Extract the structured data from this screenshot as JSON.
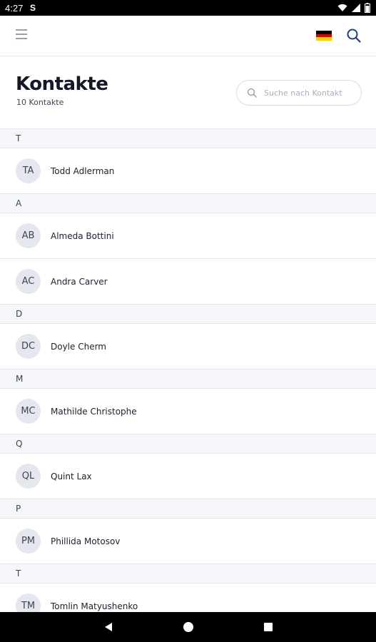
{
  "status_bar": {
    "time": "4:27",
    "notification_icon": "S",
    "icons": [
      "wifi-icon",
      "signal-icon",
      "battery-icon"
    ]
  },
  "app_bar": {
    "menu_icon": "hamburger-menu-icon",
    "language_flag": "german-flag-icon",
    "search_icon": "search-icon"
  },
  "header": {
    "title": "Kontakte",
    "count_label": "10 Kontakte"
  },
  "search": {
    "placeholder": "Suche nach Kontakt",
    "value": ""
  },
  "sections": [
    {
      "letter": "T",
      "contacts": [
        {
          "initials": "TA",
          "name": "Todd Adlerman"
        }
      ]
    },
    {
      "letter": "A",
      "contacts": [
        {
          "initials": "AB",
          "name": "Almeda Bottini"
        },
        {
          "initials": "AC",
          "name": "Andra Carver"
        }
      ]
    },
    {
      "letter": "D",
      "contacts": [
        {
          "initials": "DC",
          "name": "Doyle Cherm"
        }
      ]
    },
    {
      "letter": "M",
      "contacts": [
        {
          "initials": "MC",
          "name": "Mathilde Christophe"
        }
      ]
    },
    {
      "letter": "Q",
      "contacts": [
        {
          "initials": "QL",
          "name": "Quint Lax"
        }
      ]
    },
    {
      "letter": "P",
      "contacts": [
        {
          "initials": "PM",
          "name": "Phillida Motosov"
        }
      ]
    },
    {
      "letter": "T",
      "contacts": [
        {
          "initials": "TM",
          "name": "Tomlin Matyushenko"
        }
      ]
    }
  ],
  "nav_bar": {
    "icons": [
      "back-icon",
      "home-icon",
      "recents-icon"
    ]
  },
  "colors": {
    "flag_black": "#000000",
    "flag_red": "#dd0000",
    "flag_gold": "#ffce00",
    "accent_blue": "#1f3c88"
  }
}
